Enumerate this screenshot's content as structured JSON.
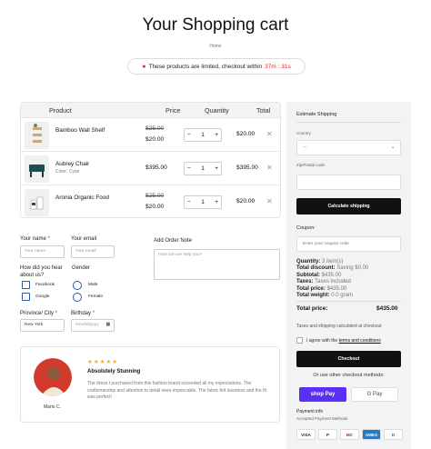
{
  "header": {
    "title": "Your Shopping cart",
    "breadcrumb": "Home"
  },
  "notice": {
    "text": "These products are limited, checkout within",
    "time": "37m : 31s"
  },
  "table": {
    "headers": [
      "Product",
      "Price",
      "Quantity",
      "Total"
    ],
    "rows": [
      {
        "name": "Bamboo Wall Shelf",
        "variant": "",
        "old_price": "$25.00",
        "price": "$20.00",
        "qty": "1",
        "total": "$20.00"
      },
      {
        "name": "Aubrey Chair",
        "variant": "Color: Cyan",
        "old_price": "",
        "price": "$395.00",
        "qty": "1",
        "total": "$395.00"
      },
      {
        "name": "Aronia Organic Food",
        "variant": "",
        "old_price": "$25.00",
        "price": "$20.00",
        "qty": "1",
        "total": "$20.00"
      }
    ]
  },
  "form": {
    "name_label": "Your name",
    "name_placeholder": "Your name",
    "email_label": "Your email",
    "email_placeholder": "Your email",
    "hear_label": "How did you hear about us?",
    "hear_options": [
      "Facebook",
      "Google"
    ],
    "gender_label": "Gender",
    "gender_options": [
      "Male",
      "Female"
    ],
    "province_label": "Province/ City",
    "province_value": "New York",
    "birthday_label": "Birthday",
    "birthday_placeholder": "mm/dd/yyyy",
    "note_label": "Add Order Note",
    "note_placeholder": "How can we help you?"
  },
  "review": {
    "stars": "★★★★★",
    "title": "Absolutely Stunning",
    "text": "The dress I purchased from this fashion brand exceeded all my expectations. The craftsmanship and attention to detail were impeccable. The fabric felt luxurious and the fit was perfect!",
    "author": "Mario C."
  },
  "sidebar": {
    "estimate_title": "Estimate Shipping",
    "country_label": "Country",
    "country_value": "---",
    "zip_label": "Zip/Postal code",
    "calc_button": "Calculate shipping",
    "coupon_label": "Coupon:",
    "coupon_placeholder": "Enter your coupon code",
    "quantity_label": "Quantity:",
    "quantity_value": "3 item(s)",
    "discount_label": "Total discount:",
    "discount_value": "Saving $0.00",
    "subtotal_label": "Subtotal:",
    "subtotal_value": "$435.00",
    "taxes_label": "Taxes:",
    "taxes_value": "Taxes included",
    "totalprice_label": "Total price:",
    "totalprice_value": "$435.00",
    "weight_label": "Total weight:",
    "weight_value": "0.0 gram",
    "total_label": "Total price:",
    "total_value": "$435.00",
    "tax_note": "Taxes and shipping calculated at checkout",
    "agree_prefix": "I agree with the",
    "agree_link": "terms and conditions",
    "checkout_button": "Checkout",
    "other_methods": "Or use other checkout methods:",
    "shoppay": "shop Pay",
    "gpay": "G Pay",
    "payment_info": "Payment info",
    "accepted": "Accepted Payment Methods",
    "cards": [
      "VISA",
      "P",
      "MC",
      "AMEX",
      "D"
    ]
  },
  "colors": {
    "accent": "#e0242a",
    "button": "#111111",
    "shoppay": "#5a31f4",
    "link_blue": "#2a5aa0"
  }
}
